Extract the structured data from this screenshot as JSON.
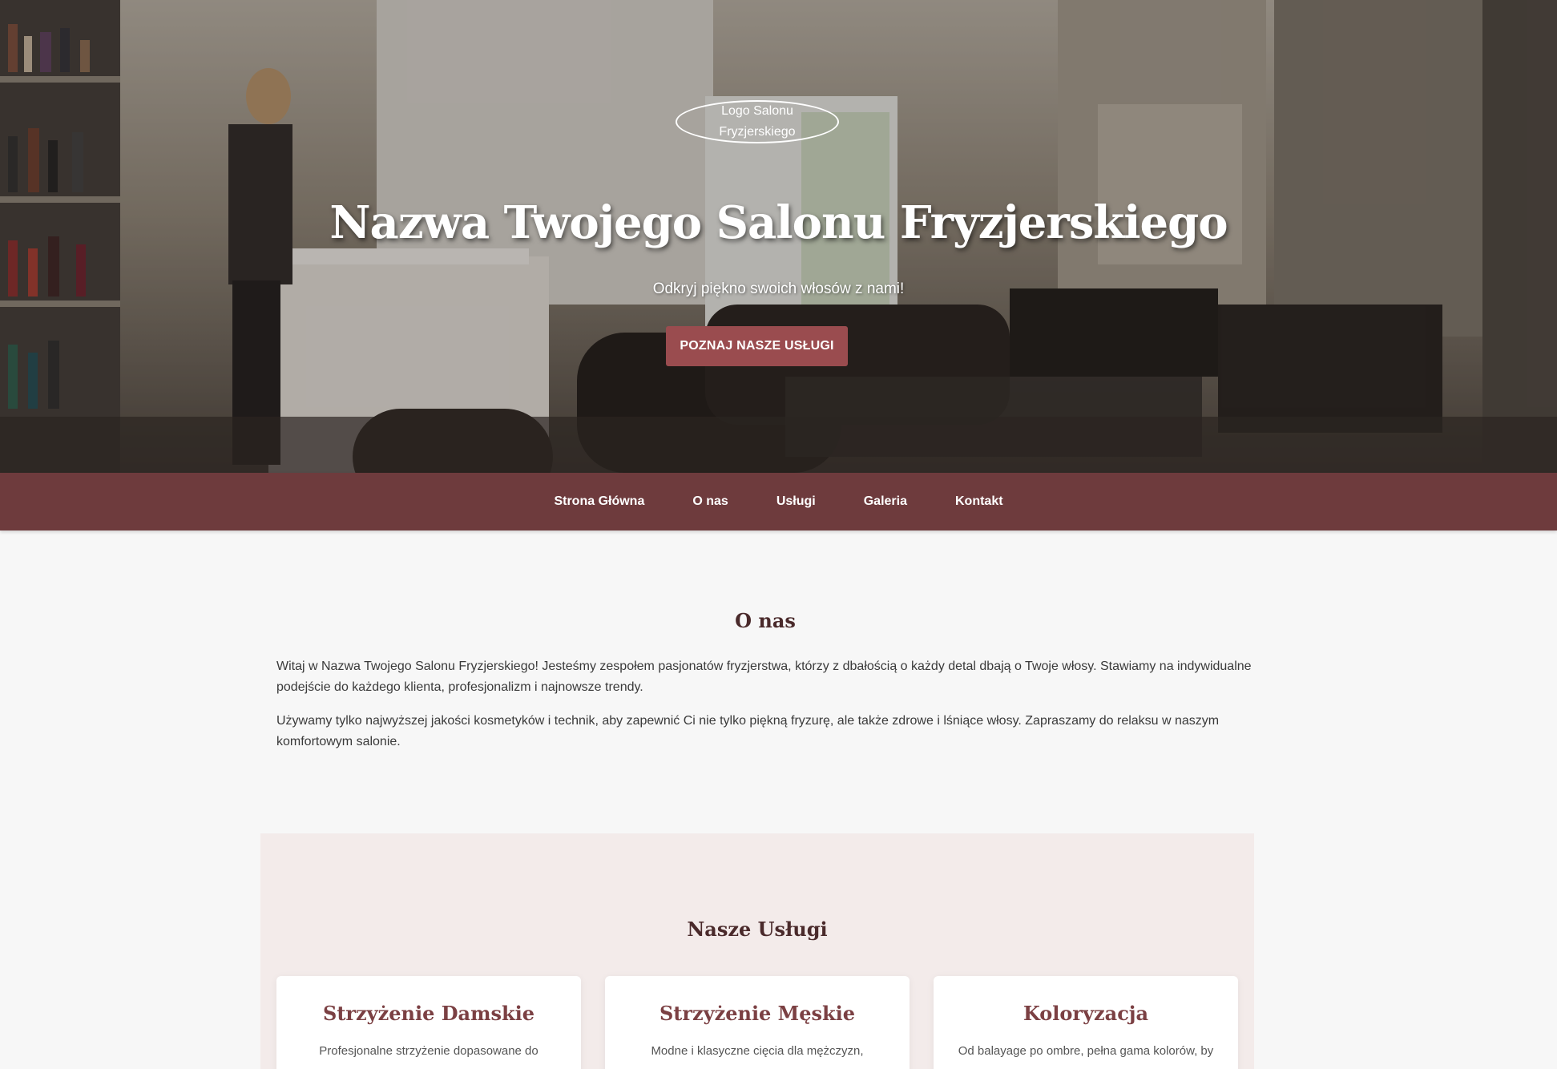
{
  "hero": {
    "logo_text": "Logo Salonu Fryzjerskiego",
    "title": "Nazwa Twojego Salonu Fryzjerskiego",
    "subtitle": "Odkryj piękno swoich włosów z nami!",
    "cta_label": "POZNAJ NASZE USŁUGI"
  },
  "nav": {
    "items": [
      {
        "label": "Strona Główna"
      },
      {
        "label": "O nas"
      },
      {
        "label": "Usługi"
      },
      {
        "label": "Galeria"
      },
      {
        "label": "Kontakt"
      }
    ]
  },
  "about": {
    "title": "O nas",
    "paragraphs": [
      "Witaj w Nazwa Twojego Salonu Fryzjerskiego! Jesteśmy zespołem pasjonatów fryzjerstwa, którzy z dbałością o każdy detal dbają o Twoje włosy. Stawiamy na indywidualne podejście do każdego klienta, profesjonalizm i najnowsze trendy.",
      "Używamy tylko najwyższej jakości kosmetyków i technik, aby zapewnić Ci nie tylko piękną fryzurę, ale także zdrowe i lśniące włosy. Zapraszamy do relaksu w naszym komfortowym salonie."
    ]
  },
  "services": {
    "title": "Nasze Usługi",
    "cards": [
      {
        "title": "Strzyżenie Damskie",
        "description": "Profesjonalne strzyżenie dopasowane do"
      },
      {
        "title": "Strzyżenie Męskie",
        "description": "Modne i klasyczne cięcia dla mężczyzn,"
      },
      {
        "title": "Koloryzacja",
        "description": "Od balayage po ombre, pełna gama kolorów, by"
      }
    ]
  },
  "colors": {
    "nav_bg": "#6e3b3d",
    "accent_button": "#9a4c4f",
    "heading": "#4a2a2b",
    "card_title": "#7b4043",
    "services_bg": "#f3ebea"
  }
}
